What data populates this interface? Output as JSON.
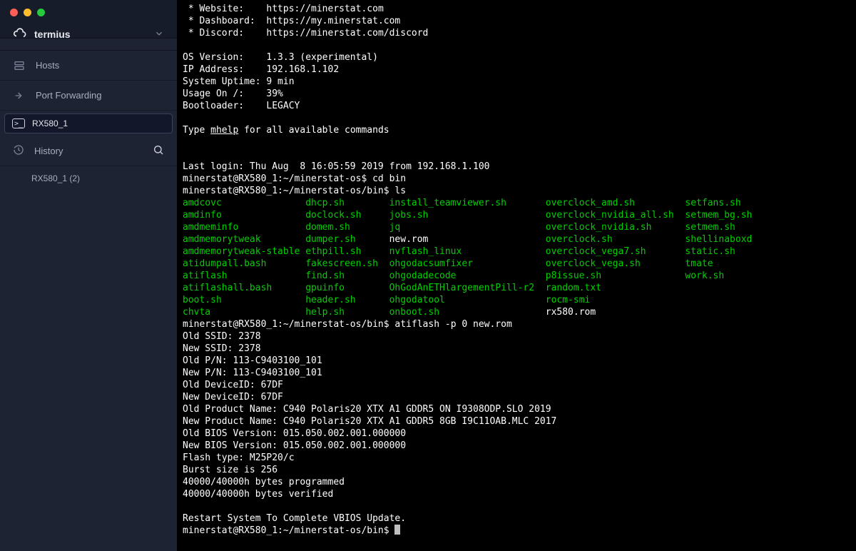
{
  "brand": {
    "name": "termius"
  },
  "nav": {
    "hosts": "Hosts",
    "port_forwarding": "Port Forwarding"
  },
  "tab": {
    "label": "RX580_1"
  },
  "history": {
    "label": "History",
    "items": [
      "RX580_1 (2)"
    ]
  },
  "banner": {
    "website_k": " * Website:",
    "website_v": "https://minerstat.com",
    "dash_k": " * Dashboard:",
    "dash_v": "https://my.minerstat.com",
    "discord_k": " * Discord:",
    "discord_v": "https://minerstat.com/discord",
    "osver_k": "OS Version:",
    "osver_v": "1.3.3 (experimental)",
    "ip_k": "IP Address:",
    "ip_v": "192.168.1.102",
    "uptime_k": "System Uptime:",
    "uptime_v": "9 min",
    "usage_k": "Usage On /:",
    "usage_v": "39%",
    "boot_k": "Bootloader:",
    "boot_v": "LEGACY",
    "help_pre": "Type ",
    "help_cmd": "mhelp",
    "help_post": " for all available commands"
  },
  "session": {
    "lastlogin": "Last login: Thu Aug  8 16:05:59 2019 from 192.168.1.100",
    "prompt1": "minerstat@RX580_1:~/minerstat-os$ ",
    "cmd1": "cd bin",
    "prompt2": "minerstat@RX580_1:~/minerstat-os/bin$ ",
    "cmd2": "ls"
  },
  "ls": {
    "col1": [
      "amdcovc",
      "amdinfo",
      "amdmeminfo",
      "amdmemorytweak",
      "amdmemorytweak-stable",
      "atidumpall.bash",
      "atiflash",
      "atiflashall.bash",
      "boot.sh",
      "chvta"
    ],
    "col2": [
      "dhcp.sh",
      "doclock.sh",
      "domem.sh",
      "dumper.sh",
      "ethpill.sh",
      "fakescreen.sh",
      "find.sh",
      "gpuinfo",
      "header.sh",
      "help.sh"
    ],
    "col3": [
      "install_teamviewer.sh",
      "jobs.sh",
      "jq",
      "new.rom",
      "nvflash_linux",
      "ohgodacsumfixer",
      "ohgodadecode",
      "OhGodAnETHlargementPill-r2",
      "ohgodatool",
      "onboot.sh"
    ],
    "col4": [
      "overclock_amd.sh",
      "overclock_nvidia_all.sh",
      "overclock_nvidia.sh",
      "overclock.sh",
      "overclock_vega7.sh",
      "overclock_vega.sh",
      "p8issue.sh",
      "random.txt",
      "rocm-smi",
      "rx580.rom"
    ],
    "col5": [
      "setfans.sh",
      "setmem_bg.sh",
      "setmem.sh",
      "shellinaboxd",
      "static.sh",
      "tmate",
      "work.sh",
      "",
      "",
      ""
    ],
    "plain": {
      "r3c3": true,
      "r9c4": true
    }
  },
  "flash": {
    "prompt": "minerstat@RX580_1:~/minerstat-os/bin$ ",
    "cmd": "atiflash -p 0 new.rom",
    "lines": [
      "Old SSID: 2378",
      "New SSID: 2378",
      "Old P/N: 113-C9403100_101",
      "New P/N: 113-C9403100_101",
      "Old DeviceID: 67DF",
      "New DeviceID: 67DF",
      "Old Product Name: C940 Polaris20 XTX A1 GDDR5 ON I9308ODP.SLO 2019",
      "New Product Name: C940 Polaris20 XTX A1 GDDR5 8GB I9C11OAB.MLC 2017",
      "Old BIOS Version: 015.050.002.001.000000",
      "New BIOS Version: 015.050.002.001.000000",
      "Flash type: M25P20/c",
      "Burst size is 256",
      "40000/40000h bytes programmed",
      "40000/40000h bytes verified",
      "",
      "Restart System To Complete VBIOS Update."
    ],
    "end_prompt": "minerstat@RX580_1:~/minerstat-os/bin$ "
  }
}
